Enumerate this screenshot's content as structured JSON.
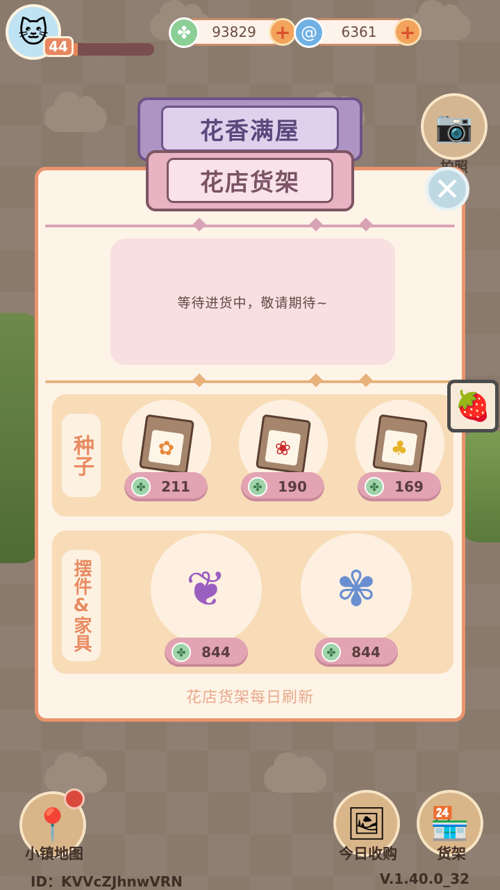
{
  "hud": {
    "level": "44",
    "xp_progress": 0.1,
    "clover_currency": "93829",
    "swirl_currency": "6361"
  },
  "side": {
    "photo_label": "拍照"
  },
  "banners": {
    "top_title": "花香满屋",
    "sub_title": "花店货架"
  },
  "notice": "等待进货中，敬请期待~",
  "sections": {
    "seeds": {
      "label": "种子",
      "items": [
        {
          "name": "orange-flower-seed",
          "price": "211"
        },
        {
          "name": "red-flower-seed",
          "price": "190"
        },
        {
          "name": "yellow-tulip-seed",
          "price": "169"
        }
      ]
    },
    "furniture": {
      "label": "摆件&家具",
      "items": [
        {
          "name": "wisteria-vase",
          "price": "844"
        },
        {
          "name": "flower-shelf",
          "price": "844"
        }
      ]
    }
  },
  "footer_note": "花店货架每日刷新",
  "bottom": {
    "map_label": "小镇地图",
    "today_label": "今日收购",
    "shelf_label": "货架",
    "user_id": "ID：KVVcZJhnwVRN",
    "version": "V.1.40.0_32"
  },
  "colors": {
    "panel_border": "#e9946d",
    "price_pill": "#e2a4b2",
    "section_bg": "#f8dcb8",
    "title_purple": "#ae94c2",
    "title_pink": "#e8b3c2"
  }
}
